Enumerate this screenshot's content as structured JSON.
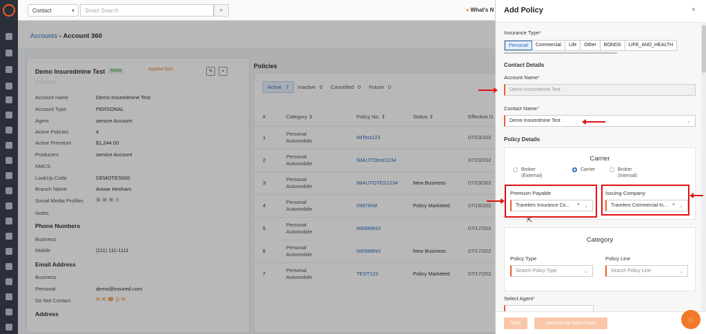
{
  "topbar": {
    "contact_select": "Contact",
    "search_placeholder": "Smart Search",
    "whats_new": "What's N"
  },
  "breadcrumb": {
    "root": "Accounts",
    "current": "Account 360"
  },
  "account": {
    "name": "Demo Insuredmine Test",
    "status": "Active",
    "applied_logo": "Applied Epic",
    "stars": "☆☆☆☆☆",
    "details": [
      {
        "label": "Account name",
        "value": "Demo Insuredmine Test"
      },
      {
        "label": "Account Type",
        "value": "PERSONAL"
      },
      {
        "label": "Agent",
        "value": "service Account"
      },
      {
        "label": "Active Policies",
        "value": "4"
      },
      {
        "label": "Active Premium",
        "value": "$1,244.00"
      },
      {
        "label": "Producers",
        "value": "service Account"
      },
      {
        "label": "NMCS",
        "value": ""
      },
      {
        "label": "LookUp Code",
        "value": "DEMOTES000"
      },
      {
        "label": "Branch Name",
        "value": "Anwar Hesham"
      },
      {
        "label": "Social Media Profiles",
        "value": ""
      },
      {
        "label": "Notes",
        "value": ""
      }
    ],
    "phone_section": "Phone Numbers",
    "phones": [
      {
        "label": "Business",
        "value": ""
      },
      {
        "label": "Mobile",
        "value": "(111) 111-1111"
      }
    ],
    "email_section": "Email Address",
    "emails": [
      {
        "label": "Business",
        "value": ""
      },
      {
        "label": "Personal",
        "value": "demo@insured.com"
      },
      {
        "label": "Do Not Contact",
        "value": ""
      }
    ],
    "address_section": "Address"
  },
  "policies": {
    "title": "Policies",
    "filters": [
      {
        "label": "Active",
        "count": "7"
      },
      {
        "label": "Inactive",
        "count": "0"
      },
      {
        "label": "Cancelled",
        "count": "0"
      },
      {
        "label": "Future",
        "count": "0"
      }
    ],
    "columns": [
      "#",
      "Category ⇕",
      "Policy No. ⇕",
      "Status ⇕",
      "Effective D"
    ],
    "rows": [
      {
        "num": "1",
        "cat1": "Personal",
        "cat2": "Automobile",
        "policy": "IMTest123",
        "status": "",
        "eff": "07/23/202"
      },
      {
        "num": "2",
        "cat1": "Personal",
        "cat2": "Automobile",
        "policy": "IMAUTOtest1234",
        "status": "",
        "eff": "07/23/202"
      },
      {
        "num": "3",
        "cat1": "Personal",
        "cat2": "Automobile",
        "policy": "IMAUTOTES1234",
        "status": "New Business",
        "eff": "07/23/202"
      },
      {
        "num": "4",
        "cat1": "Personal",
        "cat2": "Automobile",
        "policy": "0987IKM",
        "status": "Policy Marketed",
        "eff": "07/18/202"
      },
      {
        "num": "5",
        "cat1": "Personal",
        "cat2": "Automobile",
        "policy": "IM0988NX",
        "status": "",
        "eff": "07/17/202"
      },
      {
        "num": "6",
        "cat1": "Personal",
        "cat2": "Automobile",
        "policy": "IM0988NX",
        "status": "New Business",
        "eff": "07/17/202"
      },
      {
        "num": "7",
        "cat1": "Personal",
        "cat2": "Automobile",
        "policy": "TEST123",
        "status": "Policy Marketed",
        "eff": "07/17/202"
      }
    ]
  },
  "modal": {
    "title": "Add Policy",
    "close": "×",
    "insurance_type_label": "Insurance Type",
    "insurance_types": [
      "Personal",
      "Commercial",
      "Life",
      "Other",
      "BONDS",
      "LIFE_AND_HEALTH"
    ],
    "selected_type": "Personal",
    "contact_details": "Contact Details",
    "account_name_label": "Account Name",
    "account_name_value": "Demo Insuredmine Test",
    "contact_name_label": "Contact Name",
    "contact_name_value": "Demo Insuredmine Test",
    "policy_details": "Policy Details",
    "carrier_title": "Carrier",
    "carrier_options": [
      {
        "line1": "Broker",
        "line2": "(External)",
        "checked": false
      },
      {
        "line1": "Carrier",
        "line2": "",
        "checked": true
      },
      {
        "line1": "Broker",
        "line2": "(Internal)",
        "checked": false
      }
    ],
    "premium_payable_label": "Premium Payable",
    "premium_payable_value": "Travelers Insurance Co...",
    "issuing_company_label": "Issuing Company",
    "issuing_company_value": "Travelers Commercial In...",
    "category_title": "Category",
    "policy_type_label": "Policy Type",
    "policy_type_placeholder": "Search Policy Type",
    "policy_line_label": "Policy Line",
    "policy_line_placeholder": "Search Policy Line",
    "select_agent_label": "Select Agent",
    "save_label": "Save",
    "add_new_label": "Add New for Same Client"
  },
  "colors": {
    "accent": "#f05a28",
    "link": "#2c6fbb",
    "annotation": "#e01010"
  }
}
